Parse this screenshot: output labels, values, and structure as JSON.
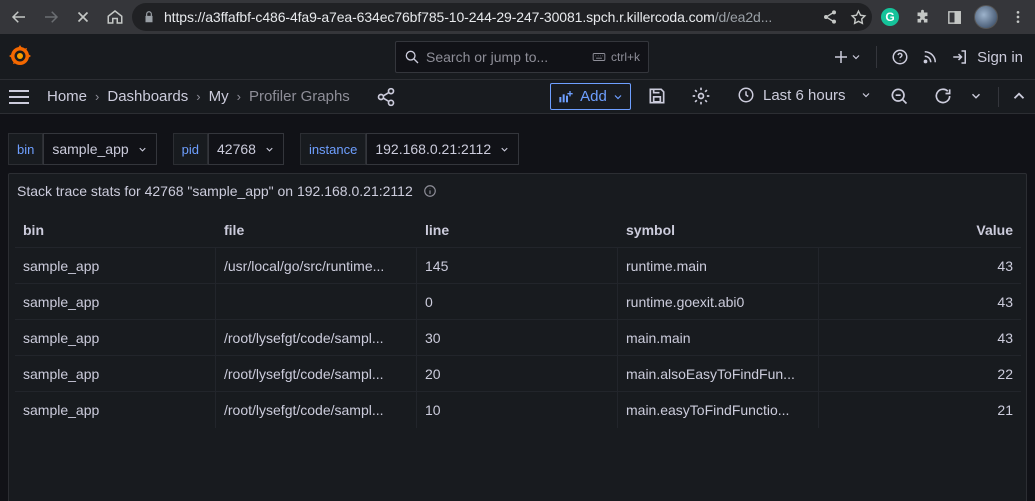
{
  "browser": {
    "url_main": "https://a3ffafbf-c486-4fa9-a7ea-634ec76bf785-10-244-29-247-30081.spch.r.killercoda.com",
    "url_rest": "/d/ea2d..."
  },
  "topbar": {
    "search_placeholder": "Search or jump to...",
    "search_shortcut": "ctrl+k",
    "signin_label": "Sign in"
  },
  "breadcrumb": {
    "home": "Home",
    "dashboards": "Dashboards",
    "my": "My",
    "current": "Profiler Graphs"
  },
  "toolbar": {
    "add_label": "Add",
    "time_range": "Last 6 hours"
  },
  "variables": [
    {
      "label": "bin",
      "value": "sample_app"
    },
    {
      "label": "pid",
      "value": "42768"
    },
    {
      "label": "instance",
      "value": "192.168.0.21:2112"
    }
  ],
  "panel": {
    "title": "Stack trace stats for 42768 \"sample_app\" on 192.168.0.21:2112",
    "columns": [
      "bin",
      "file",
      "line",
      "symbol",
      "Value"
    ],
    "rows": [
      [
        "sample_app",
        "/usr/local/go/src/runtime...",
        "145",
        "runtime.main",
        "43"
      ],
      [
        "sample_app",
        "",
        "0",
        "runtime.goexit.abi0",
        "43"
      ],
      [
        "sample_app",
        "/root/lysefgt/code/sampl...",
        "30",
        "main.main",
        "43"
      ],
      [
        "sample_app",
        "/root/lysefgt/code/sampl...",
        "20",
        "main.alsoEasyToFindFun...",
        "22"
      ],
      [
        "sample_app",
        "/root/lysefgt/code/sampl...",
        "10",
        "main.easyToFindFunctio...",
        "21"
      ]
    ]
  },
  "colors": {
    "accent": "#6e9fff",
    "background": "#111217",
    "panel": "#181b1f"
  }
}
